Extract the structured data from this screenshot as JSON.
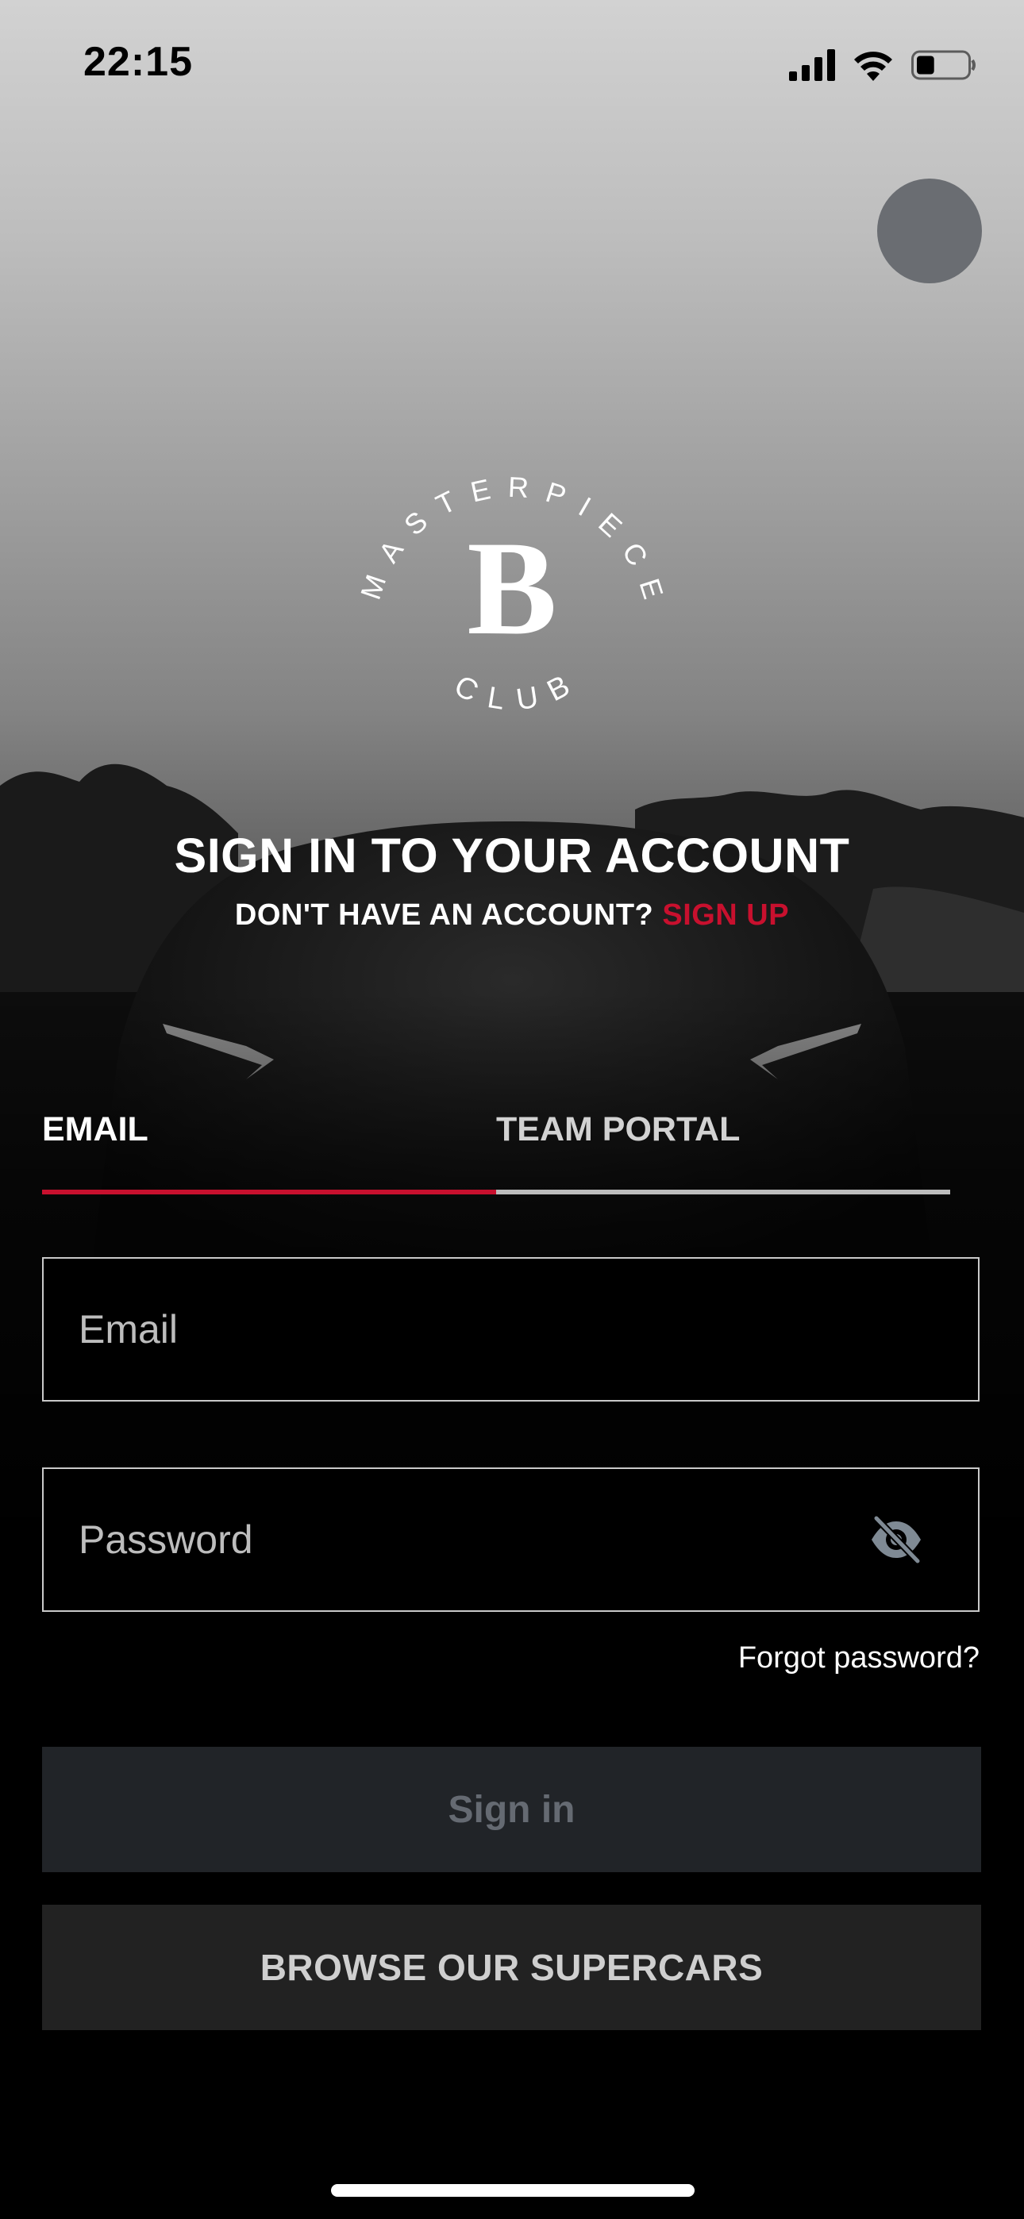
{
  "status_bar": {
    "time": "22:15",
    "icons": [
      "cellular-signal-icon",
      "wifi-icon",
      "battery-icon"
    ],
    "battery_level": 0.35
  },
  "profile": {
    "icon": "avatar-circle",
    "color": "#6a6d72"
  },
  "logo": {
    "ring_text": "MASTERPIECE",
    "bottom_text": "CLUB",
    "monogram": "B"
  },
  "header": {
    "title": "SIGN IN TO YOUR ACCOUNT",
    "prompt": "DON'T HAVE AN ACCOUNT?",
    "signup_link": "SIGN UP"
  },
  "tabs": [
    {
      "label": "EMAIL",
      "active": true
    },
    {
      "label": "TEAM PORTAL",
      "active": false
    }
  ],
  "form": {
    "email": {
      "placeholder": "Email",
      "value": ""
    },
    "password": {
      "placeholder": "Password",
      "value": "",
      "toggle_icon": "eye-slash-icon"
    },
    "forgot_link": "Forgot password?"
  },
  "actions": {
    "sign_in_label": "Sign in",
    "browse_label": "BROWSE OUR SUPERCARS"
  },
  "colors": {
    "accent": "#c8102e",
    "sign_in_bg": "#212428",
    "sign_in_text": "#656a72",
    "browse_bg": "#222222"
  }
}
